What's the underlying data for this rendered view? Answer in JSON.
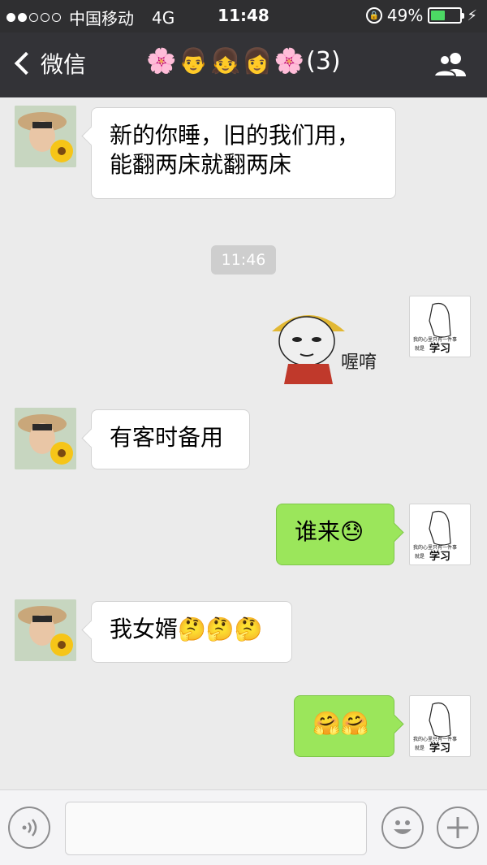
{
  "status_bar": {
    "carrier": "中国移动",
    "network": "4G",
    "time": "11:48",
    "battery_percent": "49%",
    "battery_level": 0.49,
    "signal_bars_filled": 2,
    "signal_bars_total": 5
  },
  "nav": {
    "back_label": "微信",
    "title_emojis": [
      "🌸",
      "👨",
      "👧",
      "👩",
      "🌸"
    ],
    "member_count": "(3)"
  },
  "messages": [
    {
      "side": "in",
      "text_lines": [
        "新的你睡，旧的我们用，",
        "能翻两床就翻两床"
      ]
    },
    {
      "type": "time",
      "text": "11:46"
    },
    {
      "side": "out",
      "sticker_text": "喔唷"
    },
    {
      "side": "in",
      "text": "有客时备用"
    },
    {
      "side": "out",
      "text": "谁来😓"
    },
    {
      "side": "in",
      "text": "我女婿🤔🤔🤔"
    },
    {
      "side": "out",
      "text": "🤗🤗"
    }
  ],
  "my_avatar_text": {
    "line1": "我的心里只有一件事",
    "line2": "就是",
    "line3": "学习"
  },
  "colors": {
    "nav_bg": "#333337",
    "status_bg": "#2f2f31",
    "outgoing_bubble": "#9be65b",
    "chat_bg": "#ebebeb",
    "battery": "#4cd964"
  },
  "icons": {
    "back": "chevron-left-icon",
    "group": "contacts-icon",
    "voice": "voice-icon",
    "emoji": "smiley-icon",
    "plus": "plus-icon"
  }
}
